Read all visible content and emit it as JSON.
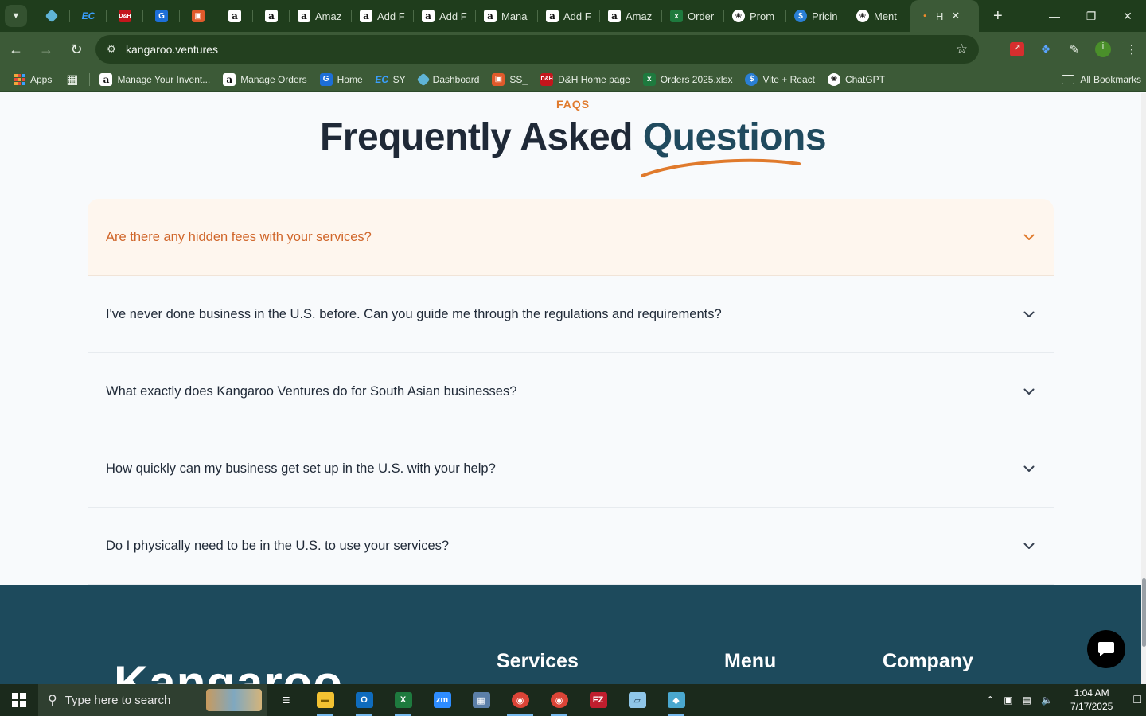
{
  "browser": {
    "tabs": [
      {
        "type": "pinned",
        "icon": "kangaroo-hex-icon",
        "label": ""
      },
      {
        "type": "pinned",
        "icon": "ec-icon",
        "label": ""
      },
      {
        "type": "pinned",
        "icon": "dh-icon",
        "label": ""
      },
      {
        "type": "pinned",
        "icon": "google-doc-icon",
        "label": ""
      },
      {
        "type": "pinned",
        "icon": "package-icon",
        "label": ""
      },
      {
        "type": "pinned",
        "icon": "amazon-icon",
        "label": ""
      },
      {
        "type": "pinned",
        "icon": "amazon-icon",
        "label": ""
      },
      {
        "type": "titled",
        "icon": "amazon-icon",
        "label": "Amaz"
      },
      {
        "type": "titled",
        "icon": "amazon-icon",
        "label": "Add F"
      },
      {
        "type": "titled",
        "icon": "amazon-icon",
        "label": "Add F"
      },
      {
        "type": "titled",
        "icon": "amazon-icon",
        "label": "Mana"
      },
      {
        "type": "titled",
        "icon": "amazon-icon",
        "label": "Add F"
      },
      {
        "type": "titled",
        "icon": "amazon-icon",
        "label": "Amaz"
      },
      {
        "type": "titled",
        "icon": "excel-icon",
        "label": "Order"
      },
      {
        "type": "titled",
        "icon": "chatgpt-icon",
        "label": "Prom"
      },
      {
        "type": "titled",
        "icon": "dollar-coin-icon",
        "label": "Pricin"
      },
      {
        "type": "titled",
        "icon": "chatgpt-icon",
        "label": "Ment"
      },
      {
        "type": "active",
        "icon": "kangaroo-icon",
        "label": "H"
      }
    ],
    "url": "kangaroo.ventures",
    "bookmarks": [
      {
        "icon": "amazon-icon",
        "label": "Manage Your Invent..."
      },
      {
        "icon": "amazon-icon",
        "label": "Manage Orders"
      },
      {
        "icon": "google-doc-icon",
        "label": "Home"
      },
      {
        "icon": "ec-icon",
        "label": "SY"
      },
      {
        "icon": "kangaroo-hex-icon",
        "label": "Dashboard"
      },
      {
        "icon": "package-icon",
        "label": "SS_"
      },
      {
        "icon": "dh-icon",
        "label": "D&H Home page"
      },
      {
        "icon": "excel-icon",
        "label": "Orders 2025.xlsx"
      },
      {
        "icon": "dollar-coin-icon",
        "label": "Vite + React"
      },
      {
        "icon": "chatgpt-icon",
        "label": "ChatGPT"
      }
    ],
    "apps_label": "Apps",
    "all_bookmarks_label": "All Bookmarks",
    "profile_initial": "i"
  },
  "faq": {
    "eyebrow": "FAQS",
    "title_main": "Frequently Asked",
    "title_highlight": "Questions",
    "accent_color": "#e07a2c",
    "items": [
      {
        "question": "Are there any hidden fees with your services?",
        "open": true
      },
      {
        "question": "I've never done business in the U.S. before. Can you guide me through the regulations and requirements?",
        "open": false
      },
      {
        "question": "What exactly does Kangaroo Ventures do for South Asian businesses?",
        "open": false
      },
      {
        "question": "How quickly can my business get set up in the U.S. with your help?",
        "open": false
      },
      {
        "question": "Do I physically need to be in the U.S. to use your services?",
        "open": false
      }
    ]
  },
  "footer": {
    "brand": "Kangaroo",
    "headings": [
      "Services",
      "Menu",
      "Company"
    ],
    "background": "#1d4a5c"
  },
  "taskbar": {
    "search_placeholder": "Type here to search",
    "apps": [
      "task-view-icon",
      "file-explorer-icon",
      "outlook-icon",
      "excel-icon",
      "zoom-icon",
      "calculator-icon",
      "chrome-icon",
      "chrome-icon",
      "filezilla-icon",
      "notepad-icon",
      "kangaroo-hex-icon"
    ],
    "time": "1:04 AM",
    "date": "7/17/2025"
  }
}
